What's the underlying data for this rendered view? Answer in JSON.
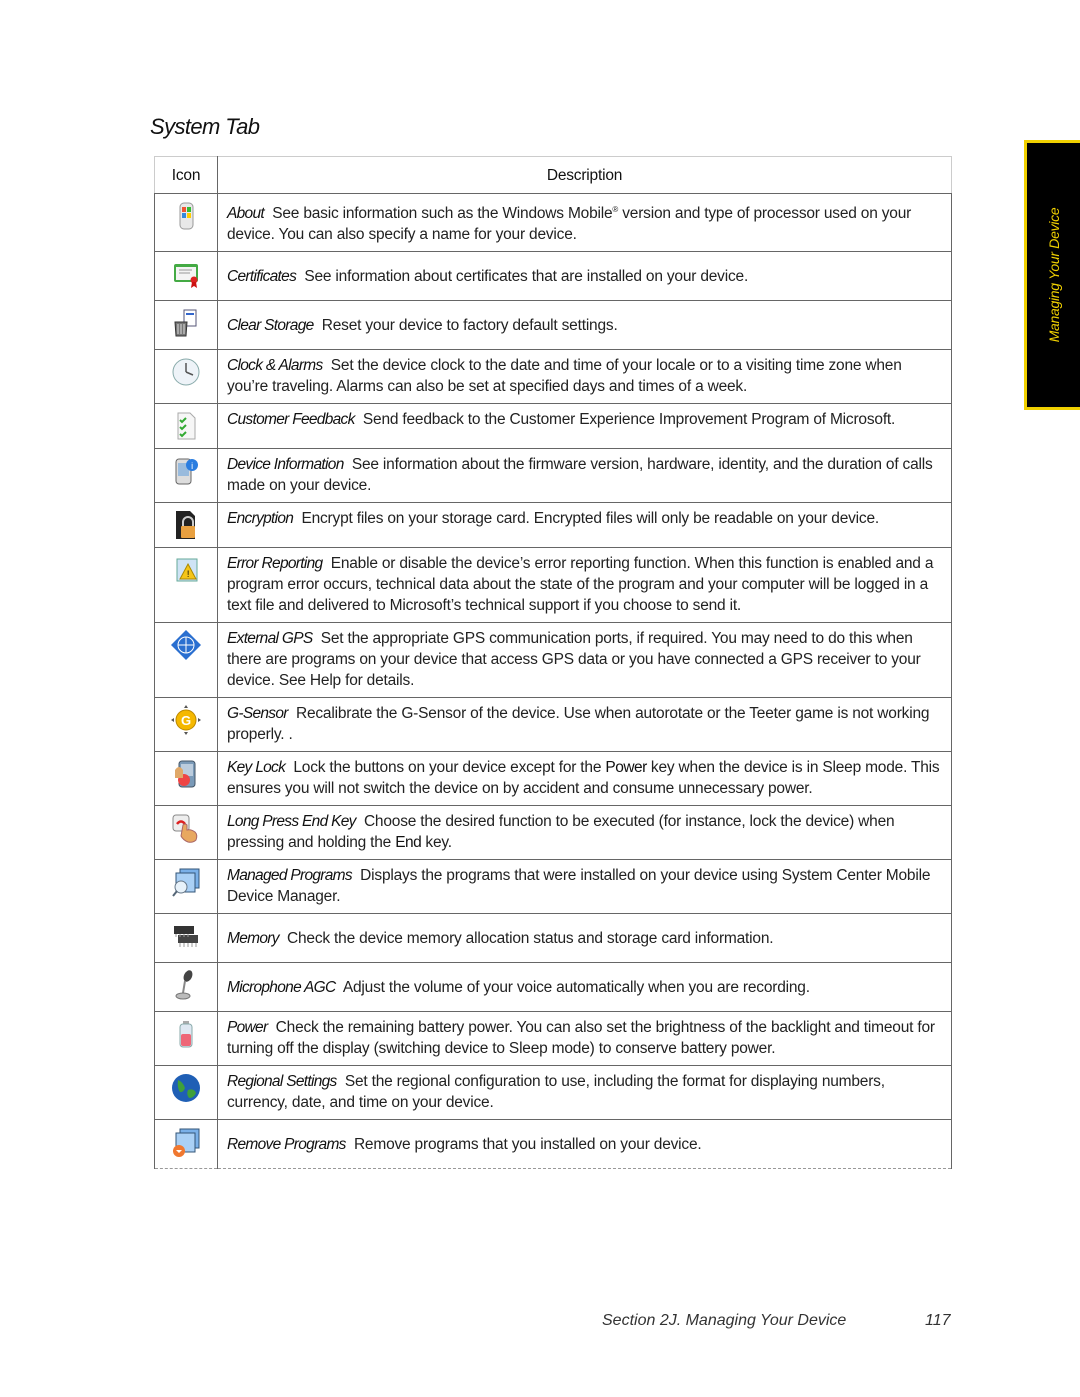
{
  "page": {
    "title": "System Tab",
    "side_tab": "Managing Your Device",
    "footer_section": "Section 2J. Managing Your Device",
    "page_number": "117"
  },
  "table": {
    "headers": {
      "icon": "Icon",
      "description": "Description"
    },
    "rows": [
      {
        "icon": "about-icon",
        "name": "About",
        "desc_before": "See basic information such as the Windows Mobile",
        "sup": "®",
        "desc": " version and type of processor used on your device. You can also specify a name for your device."
      },
      {
        "icon": "certificates-icon",
        "name": "Certificates",
        "desc": "See information about certificates that are installed on your device."
      },
      {
        "icon": "clear-storage-icon",
        "name": "Clear Storage",
        "desc": "Reset your device to factory default settings."
      },
      {
        "icon": "clock-icon",
        "name": "Clock & Alarms",
        "desc": "Set the device clock to the date and time of your locale or to a visiting time zone when you’re traveling. Alarms can also be set at specified days and times of a week."
      },
      {
        "icon": "customer-feedback-icon",
        "name": "Customer Feedback",
        "desc": "Send feedback to the Customer Experience Improvement Program of Microsoft."
      },
      {
        "icon": "device-information-icon",
        "name": "Device Information",
        "desc": "See information about the firmware version, hardware, identity, and the duration of calls made on your device."
      },
      {
        "icon": "encryption-icon",
        "name": "Encryption",
        "desc": "Encrypt files on your storage card. Encrypted files will only be readable on your device."
      },
      {
        "icon": "error-reporting-icon",
        "name": "Error Reporting",
        "desc": "Enable or disable the device’s error reporting function. When this function is enabled and a program error occurs, technical data about the state of the program and your computer will be logged in a text file and delivered to Microsoft’s technical support if you choose to send it."
      },
      {
        "icon": "external-gps-icon",
        "name": "External GPS",
        "desc": "Set the appropriate GPS communication ports, if required. You may need to do this when there are programs on your device that access GPS data or you have connected a GPS receiver to your device. See Help for details."
      },
      {
        "icon": "g-sensor-icon",
        "name": "G-Sensor",
        "desc": "Recalibrate the G-Sensor of the device. Use when autorotate or the Teeter game is not working properly. ."
      },
      {
        "icon": "key-lock-icon",
        "name": "Key Lock",
        "desc_before": "Lock the buttons on your device except for the ",
        "key": "Power",
        "desc": " key when the device is in Sleep mode. This ensures you will not switch the device on by accident and consume unnecessary power."
      },
      {
        "icon": "long-press-end-key-icon",
        "name": "Long Press End Key",
        "desc_before": "Choose the desired function to be executed (for instance, lock the device) when pressing and holding the ",
        "key": "End",
        "desc": " key."
      },
      {
        "icon": "managed-programs-icon",
        "name": "Managed Programs",
        "desc": "Displays the programs that were installed on your device using System Center Mobile Device Manager."
      },
      {
        "icon": "memory-icon",
        "name": "Memory",
        "desc": "Check the device memory allocation status and storage card information."
      },
      {
        "icon": "microphone-icon",
        "name": "Microphone AGC",
        "desc": "Adjust the volume of your voice automatically when you are recording."
      },
      {
        "icon": "power-battery-icon",
        "name": "Power",
        "desc": "Check the remaining battery power. You can also set the brightness of the backlight and timeout for turning off the display (switching device to Sleep mode) to conserve battery power."
      },
      {
        "icon": "regional-settings-globe-icon",
        "name": "Regional Settings",
        "desc": "Set the regional configuration to use, including the format for displaying numbers, currency, date, and time on your device."
      },
      {
        "icon": "remove-programs-icon",
        "name": "Remove Programs",
        "desc": "Remove programs that you installed on your device."
      }
    ]
  },
  "colors": {
    "side_tab_bg": "#000000",
    "side_tab_accent": "#f0d000"
  }
}
